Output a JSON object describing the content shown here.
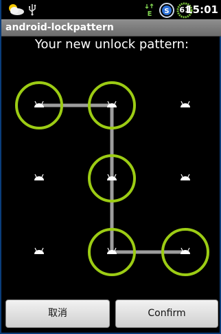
{
  "status_bar": {
    "icons": [
      "weather-icon",
      "usb-icon",
      "signal-e-icon",
      "sync-icon",
      "battery-icon"
    ],
    "signal_label": "E",
    "sync_label": "S",
    "battery_level": "61",
    "time": "15:01"
  },
  "title_bar": {
    "title": "android-lockpattern"
  },
  "main": {
    "header": "Your new unlock pattern:"
  },
  "pattern": {
    "selected_path": [
      0,
      1,
      4,
      7,
      8
    ],
    "accent_color": "#9ccc14",
    "line_color": "#b9b9b9"
  },
  "buttons": {
    "cancel_label": "取消",
    "confirm_label": "Confirm"
  }
}
